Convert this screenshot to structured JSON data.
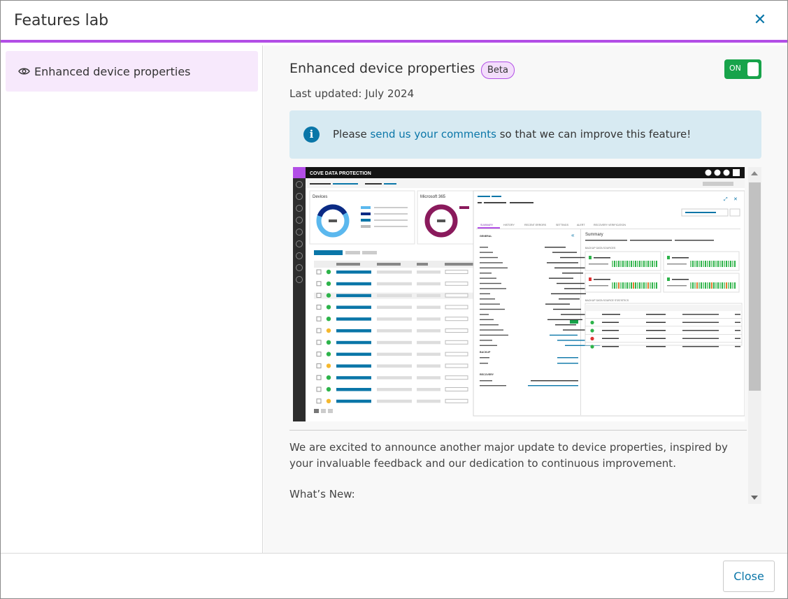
{
  "dialog": {
    "title": "Features lab",
    "close_icon_glyph": "✕"
  },
  "sidebar": {
    "items": [
      {
        "icon": "eye-icon",
        "label": "Enhanced device properties",
        "selected": true
      }
    ]
  },
  "feature": {
    "title": "Enhanced device properties",
    "badge": "Beta",
    "toggle_label": "ON",
    "toggle_state": true,
    "last_updated": "Last updated: July 2024",
    "info": {
      "icon": "info-icon",
      "icon_glyph": "i",
      "prefix": "Please ",
      "link": "send us your comments",
      "suffix": " so that we can improve this feature!"
    },
    "preview": {
      "app_name": "COVE DATA PROTECTION",
      "card1_title": "Devices",
      "card2_title": "Microsoft 365",
      "panel_tabs": [
        "SUMMARY",
        "HISTORY",
        "RECENT ERRORS",
        "SETTINGS",
        "ALERT",
        "RECOVERY VERIFICATION"
      ],
      "section_general": "GENERAL",
      "section_backup": "BACKUP",
      "section_recovery": "RECOVERY",
      "summary_title": "Summary",
      "backup_sources_title": "BACKUP DATA SOURCES",
      "backup_stats_title": "BACKUP DATA SOURCE STATISTICS"
    },
    "description": "We are excited to announce another major update to device properties, inspired by your invaluable feedback and our dedication to continuous improvement.",
    "whats_new": "What’s New:"
  },
  "footer": {
    "close_label": "Close"
  },
  "colors": {
    "accent": "#b24ee6",
    "link": "#0a76a8",
    "toggle_on": "#17a34a",
    "info_bg": "#d7eaf2",
    "selected_bg": "#f7e9fc"
  }
}
